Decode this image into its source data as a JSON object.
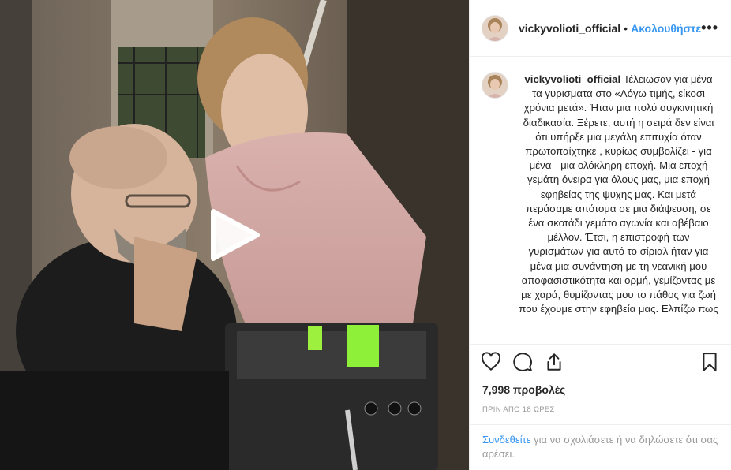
{
  "post": {
    "username": "vickyvolioti_official",
    "separator": "•",
    "follow_label": "Ακολουθήστε",
    "more_label": "•••",
    "caption": "Τέλειωσαν για μένα τα γυρισματα στο «Λόγω τιμής, είκοσι χρόνια μετά». Ήταν μια πολύ συγκινητική διαδικασία. Ξέρετε, αυτή η σειρά δεν είναι ότι υπήρξε μια μεγάλη επιτυχία όταν πρωτοπαίχτηκε , κυρίως συμβολίζει - για μένα - μια ολόκληρη εποχή. Μια εποχή γεμάτη όνειρα για όλους μας, μια εποχή εφηβείας της ψυχης μας. Και μετά περάσαμε απότομα σε μια διάψευση, σε ένα σκοτάδι γεμάτο αγωνία και αβέβαιο μέλλον. Έτσι, η επιστροφή των γυρισμάτων για αυτό το σίριαλ ήταν για μένα μια συνάντηση με τη νεανική μου αποφασιστικότητα και ορμή, γεμίζοντας με με χαρά, θυμίζοντας μου το πάθος για ζωή που έχουμε στην εφηβεία μας. Ελπίζω πως",
    "views": "7,998 προβολές",
    "timestamp": "ΠΡΙΝ ΑΠΟ 18 ΩΡΕΣ",
    "login_link": "Συνδεθείτε",
    "login_text": " για να σχολιάσετε ή να δηλώσετε ότι σας αρέσει."
  },
  "icons": {
    "play": "play-icon",
    "like": "heart-icon",
    "comment": "comment-icon",
    "share": "share-icon",
    "save": "bookmark-icon",
    "more": "more-options-icon"
  },
  "colors": {
    "link_blue": "#3897f0",
    "text": "#262626",
    "muted": "#999999",
    "border": "#efefef"
  }
}
